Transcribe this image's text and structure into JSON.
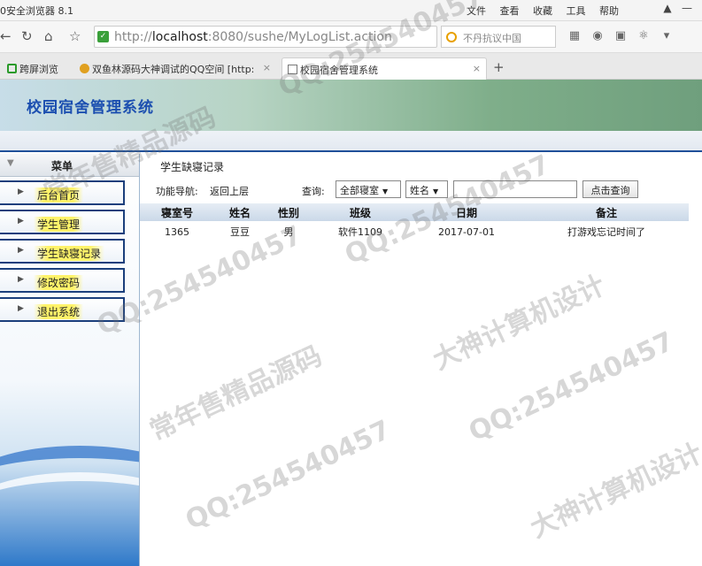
{
  "browser": {
    "title": "0安全浏览器 8.1",
    "menu": [
      "文件",
      "查看",
      "收藏",
      "工具",
      "帮助"
    ],
    "url_host": "localhost",
    "url_rest": ":8080/sushe/MyLogList.action",
    "url_prefix": "http://",
    "search_placeholder": "不丹抗议中国",
    "tabs": [
      {
        "label": "跨屏浏览"
      },
      {
        "label": "双鱼林源码大神调试的QQ空间 [http:"
      },
      {
        "label": "校园宿舍管理系统"
      }
    ]
  },
  "app": {
    "title": "校园宿舍管理系统",
    "accent": "#1c4fb0"
  },
  "sidebar": {
    "header": "菜单",
    "items": [
      {
        "label": "后台首页"
      },
      {
        "label": "学生管理"
      },
      {
        "label": "学生缺寝记录"
      },
      {
        "label": "修改密码"
      },
      {
        "label": "退出系统"
      }
    ]
  },
  "main": {
    "breadcrumb": "学生缺寝记录",
    "nav_label": "功能导航:",
    "back_link": "返回上层",
    "query_label": "查询:",
    "dorm_select": "全部寝室",
    "field_select": "姓名",
    "query_value": "",
    "query_button": "点击查询",
    "table": {
      "headers": [
        "寝室号",
        "姓名",
        "性别",
        "班级",
        "日期",
        "备注"
      ],
      "rows": [
        [
          "1365",
          "豆豆",
          "男",
          "软件1109",
          "2017-07-01",
          "打游戏忘记时间了"
        ]
      ]
    }
  },
  "watermark": {
    "qq": "QQ:254540457",
    "line1": "常年售精品源码",
    "line2": "大神计算机设计"
  }
}
